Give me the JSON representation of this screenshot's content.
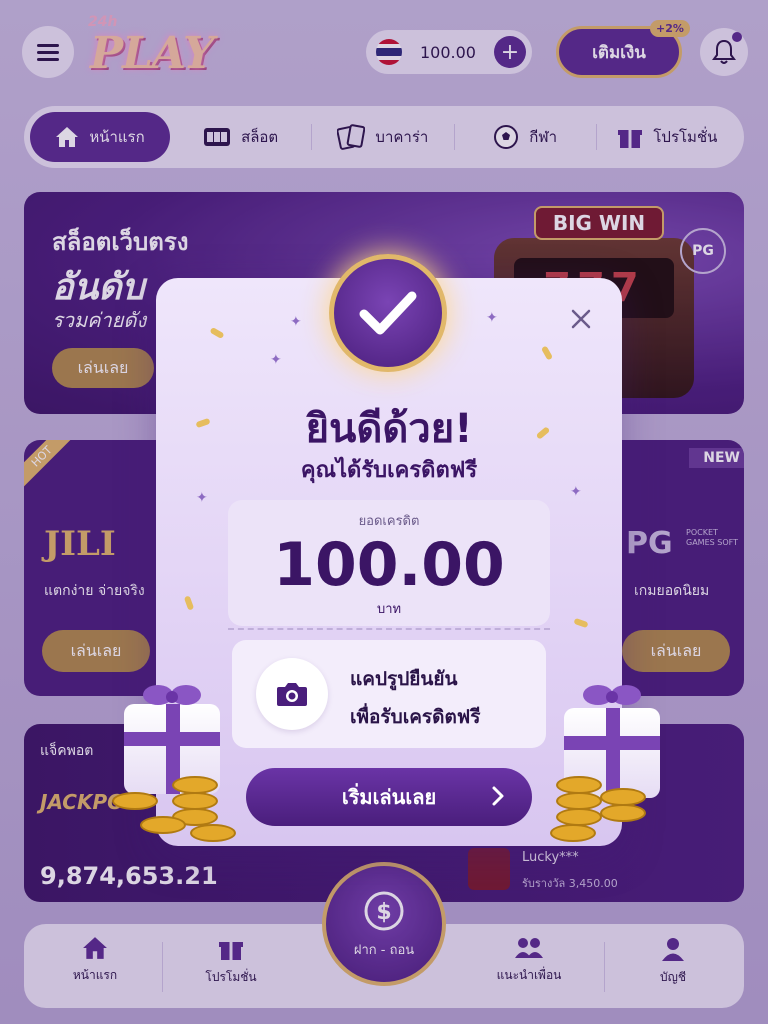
{
  "header": {
    "logo_small": "24h",
    "logo_main": "PLAY",
    "balance": "100.00",
    "topup_label": "เติมเงิน",
    "topup_badge": "+2%"
  },
  "nav_tabs": [
    {
      "label": "หน้าแรก",
      "icon": "home-icon",
      "active": true
    },
    {
      "label": "สล็อต",
      "icon": "slot-icon",
      "active": false
    },
    {
      "label": "บาคาร่า",
      "icon": "cards-icon",
      "active": false
    },
    {
      "label": "กีฬา",
      "icon": "soccer-ball-icon",
      "active": false
    },
    {
      "label": "โปรโมชั่น",
      "icon": "gift-icon",
      "active": false
    }
  ],
  "hero": {
    "line1": "สล็อตเว็บตรง",
    "line2": "อันดับ",
    "line3": "รวมค่ายดัง",
    "button": "เล่นเลย",
    "bigwin": "BIG WIN",
    "reels": "777",
    "provider_badge": "PG"
  },
  "providers": {
    "left": {
      "ribbon": "HOT",
      "logo": "JILI",
      "text": "แตกง่าย จ่ายจริง",
      "button": "เล่นเลย"
    },
    "right": {
      "ribbon": "NEW",
      "logo": "PG",
      "logo_sub": "POCKET GAMES SOFT",
      "text": "เกมยอดนิยม",
      "button": "เล่นเลย"
    }
  },
  "jackpot": {
    "label": "แจ็คพอต",
    "word": "JACKPOT",
    "amount": "9,874,653.21",
    "winner_name": "Lucky***",
    "winner_prize": "รับรางวัล 3,450.00"
  },
  "bottom_nav": {
    "home": "หน้าแรก",
    "promo": "โปรโมชั่น",
    "deposit": "ฝาก - ถอน",
    "refer": "แนะนำเพื่อน",
    "account": "บัญชี"
  },
  "modal": {
    "title": "ยินดีด้วย!",
    "subtitle": "คุณได้รับเครดิตฟรี",
    "credit_label": "ยอดเครดิต",
    "credit_amount": "100.00",
    "credit_unit": "บาท",
    "photo_line1": "แคปรูปยืนยัน",
    "photo_line2": "เพื่อรับเครดิตฟรี",
    "start_button": "เริ่มเล่นเลย"
  },
  "colors": {
    "primary": "#5a2b8f",
    "gold": "#e1b86a",
    "background": "#bcaed6"
  }
}
